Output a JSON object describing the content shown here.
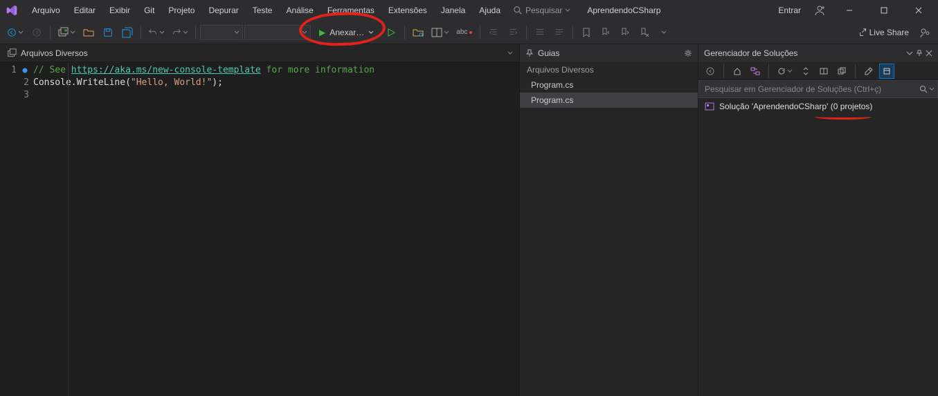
{
  "menu": {
    "items": [
      "Arquivo",
      "Editar",
      "Exibir",
      "Git",
      "Projeto",
      "Depurar",
      "Teste",
      "Análise",
      "Ferramentas",
      "Extensões",
      "Janela",
      "Ajuda"
    ],
    "search_label": "Pesquisar",
    "project_name": "AprendendoCSharp",
    "signin": "Entrar"
  },
  "toolbar": {
    "anexar_label": "Anexar…",
    "liveshare": "Live Share"
  },
  "doc_tab": {
    "label": "Arquivos Diversos"
  },
  "code": {
    "line1_comment_prefix": "// See ",
    "line1_url": "https://aka.ms/new-console-template",
    "line1_comment_suffix": " for more information",
    "line2_a": "Console",
    "line2_b": ".WriteLine(",
    "line2_str": "\"Hello, World!\"",
    "line2_c": ");"
  },
  "guias": {
    "title": "Guias",
    "group": "Arquivos Diversos",
    "items": [
      "Program.cs",
      "Program.cs"
    ],
    "selected_index": 1
  },
  "solution": {
    "title": "Gerenciador de Soluções",
    "search_placeholder": "Pesquisar em Gerenciador de Soluções (Ctrl+ç)",
    "item": "Solução 'AprendendoCSharp' (0 projetos)"
  }
}
